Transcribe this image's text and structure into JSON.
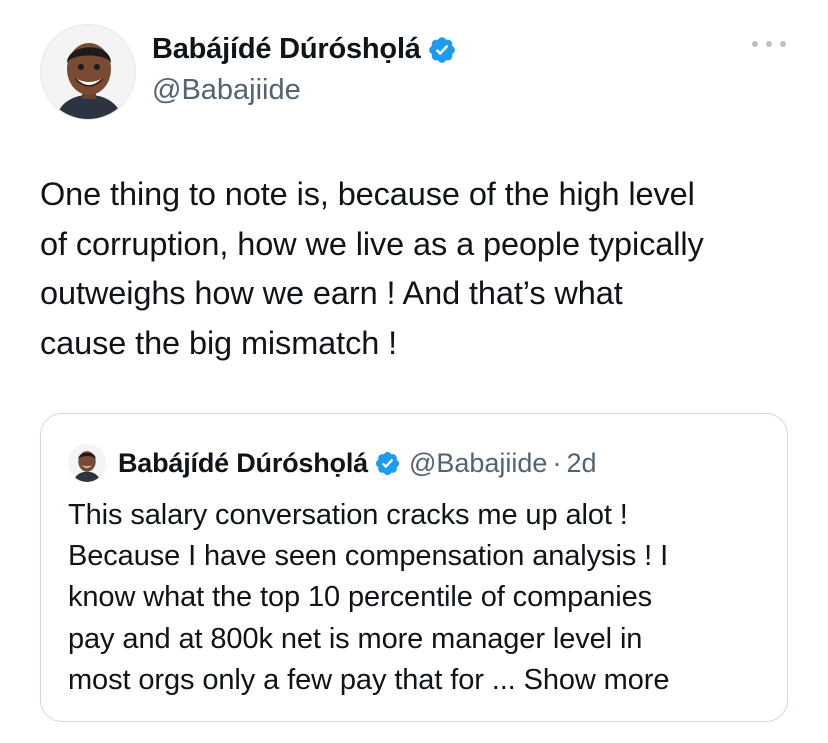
{
  "author": {
    "name": "Babájídé Dúróshọlá",
    "handle": "@Babajiide",
    "verified": true
  },
  "tweet": {
    "text": "One thing to note is, because of the high level\nof corruption, how we live as a people typically\noutweighs how we earn ! And that’s what\ncause the big mismatch !"
  },
  "more_icon": "more-horizontal-icon",
  "quoted_tweet": {
    "name": "Babájídé Dúróshọlá",
    "handle": "@Babajiide",
    "separator": "·",
    "time": "2d",
    "text": "This salary conversation cracks me up alot !\nBecause I have seen compensation analysis ! I\nknow what the top 10 percentile of companies\npay and at 800k net is more manager level in\nmost orgs only a few pay that for ... ",
    "show_more": "Show more"
  },
  "colors": {
    "text": "#0f1419",
    "secondary": "#536471",
    "verified_blue": "#1d9bf0",
    "border": "#cfd9de"
  }
}
